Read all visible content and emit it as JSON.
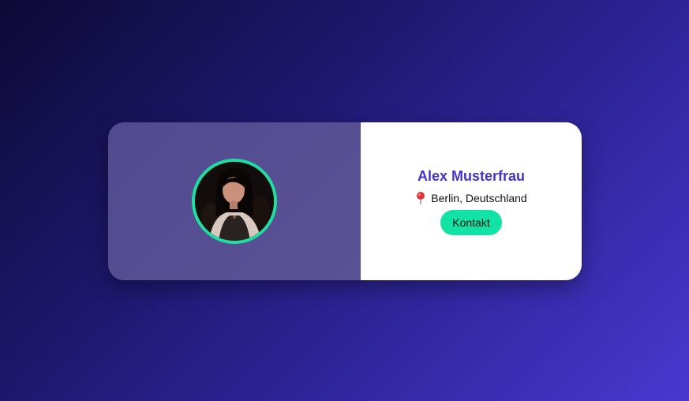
{
  "profile": {
    "name": "Alex Musterfrau",
    "location": "Berlin, Deutschland",
    "location_icon": "map-pin-icon",
    "contact_label": "Kontakt",
    "avatar": "profile-photo"
  },
  "colors": {
    "accent": "#12e3a4",
    "name_color": "#4433cc",
    "background_start": "#0d0a35",
    "background_end": "#4a38cf",
    "card_right": "#ffffff"
  }
}
